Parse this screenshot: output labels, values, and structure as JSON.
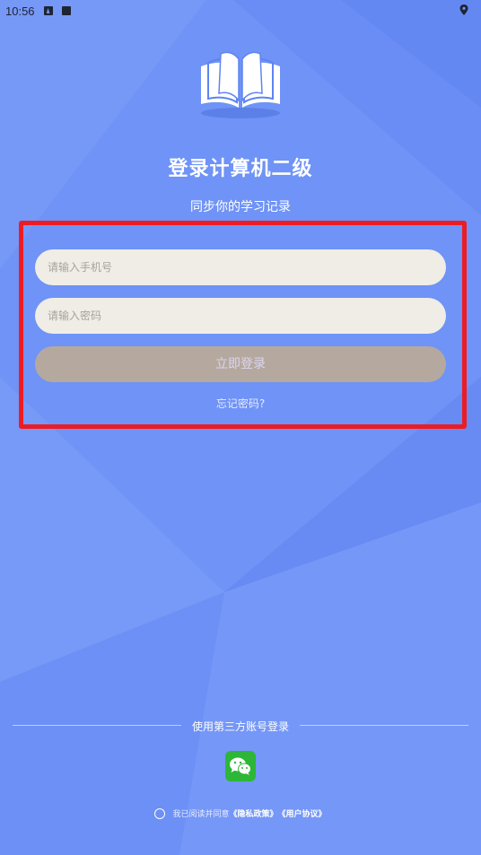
{
  "status_bar": {
    "time": "10:56"
  },
  "header": {
    "title": "登录计算机二级",
    "subtitle": "同步你的学习记录"
  },
  "form": {
    "phone_placeholder": "请输入手机号",
    "password_placeholder": "请输入密码",
    "login_label": "立即登录",
    "forgot_label": "忘记密码?"
  },
  "third_party": {
    "label": "使用第三方账号登录",
    "icons": [
      "wechat-icon"
    ]
  },
  "agreement": {
    "prefix": "我已阅读并同意",
    "privacy": "《隐私政策》",
    "terms": "《用户协议》"
  },
  "colors": {
    "background": "#6F93F6",
    "highlight_border": "#ED1C24",
    "input_bg": "#EFEDE6",
    "login_button": "#B5A99F",
    "wechat_green": "#2DB637"
  }
}
